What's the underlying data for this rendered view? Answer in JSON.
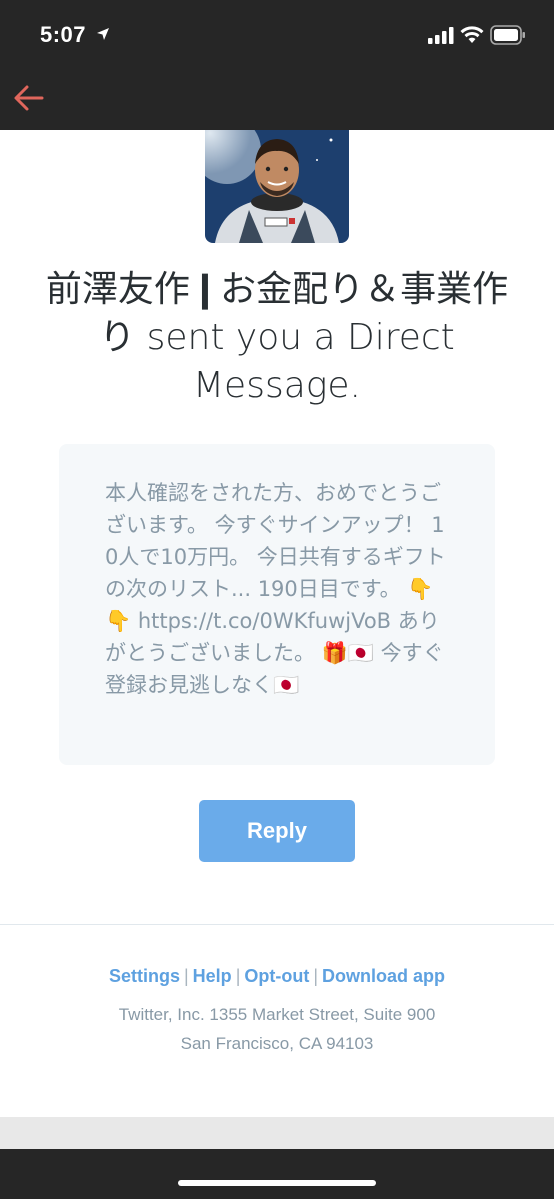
{
  "status_bar": {
    "time": "5:07",
    "icons": [
      "location-arrow-icon",
      "cellular-signal-icon",
      "wifi-icon",
      "battery-icon"
    ]
  },
  "nav": {
    "back_icon": "arrow-left-icon",
    "accent_color": "#e0665c"
  },
  "email": {
    "headline": "前澤友作❙お金配り＆事業作り sent you a Direct Message.",
    "message": "本人確認をされた方、おめでとうございます。 今すぐサインアップ！ 10人で10万円。 今日共有するギフトの次のリスト... 190日目です。 👇👇 https://t.co/0WKfuwjVoB ありがとうございました。 🎁🇯🇵 今すぐ登録お見逃しなく🇯🇵",
    "reply_label": "Reply",
    "reply_color": "#6aabea"
  },
  "footer": {
    "links": {
      "settings": "Settings",
      "help": "Help",
      "opt_out": "Opt-out",
      "download_app": "Download app"
    },
    "separator": "|",
    "address_line1": "Twitter, Inc. 1355 Market Street, Suite 900",
    "address_line2": "San Francisco, CA 94103",
    "link_color": "#5ea1e0"
  }
}
